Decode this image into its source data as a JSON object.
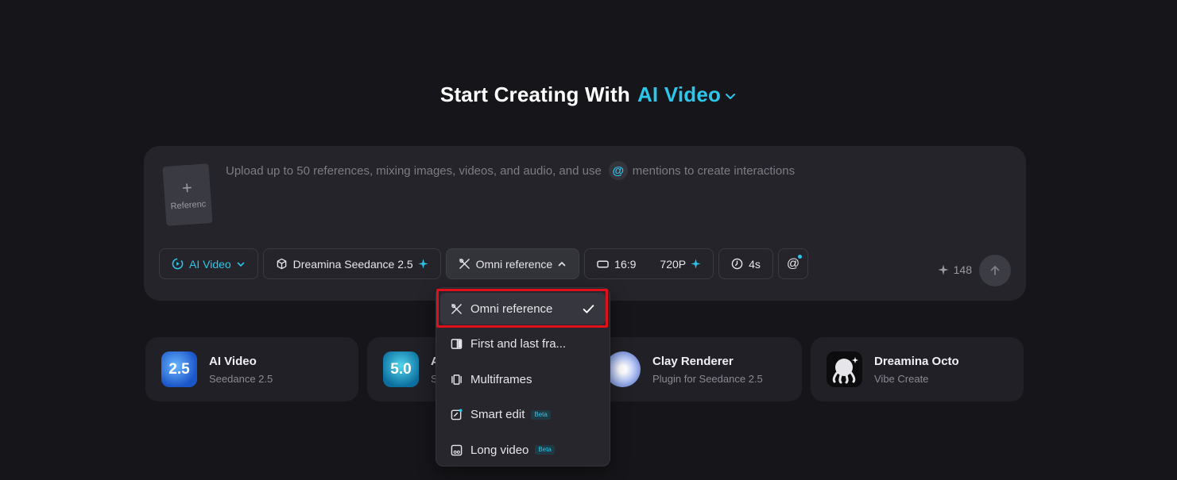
{
  "headline": {
    "prefix": "Start Creating With",
    "mode": "AI Video"
  },
  "composer": {
    "reference_label": "Referenc",
    "prompt_before": "Upload up to 50 references, mixing images, videos, and audio, and use",
    "prompt_at": "@",
    "prompt_after": "mentions to create interactions",
    "toolbar": {
      "mode": "AI Video",
      "model": "Dreamina Seedance 2.5",
      "reference": "Omni reference",
      "ratio": "16:9",
      "resolution": "720P",
      "duration": "4s",
      "mention": "@"
    },
    "credits": "148"
  },
  "dropdown": {
    "items": [
      {
        "label": "Omni reference",
        "selected": true
      },
      {
        "label": "First and last fra..."
      },
      {
        "label": "Multiframes"
      },
      {
        "label": "Smart edit",
        "badge": "Beta"
      },
      {
        "label": "Long video",
        "badge": "Beta"
      }
    ]
  },
  "cards": [
    {
      "thumb": "2.5",
      "title": "AI Video",
      "subtitle": "Seedance 2.5"
    },
    {
      "thumb": "5.0",
      "title": "A",
      "subtitle": "S"
    },
    {
      "title": "Clay Renderer",
      "subtitle": "Plugin for Seedance 2.5"
    },
    {
      "title": "Dreamina Octo",
      "subtitle": "Vibe Create"
    }
  ],
  "colors": {
    "accent": "#2ec5ea",
    "background": "#16161a",
    "panel": "#24242a",
    "highlight": "#e0101a"
  }
}
